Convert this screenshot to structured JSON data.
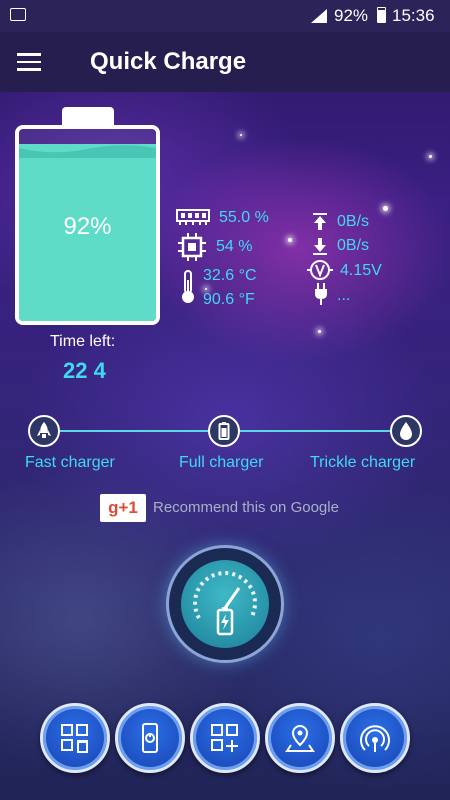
{
  "status_bar": {
    "battery_percent": "92%",
    "time": "15:36"
  },
  "app_bar": {
    "title": "Quick Charge",
    "menu_icon": "hamburger-menu-icon"
  },
  "battery": {
    "level_percent": 92,
    "label": "92%",
    "fill_color": "#5fdcc8"
  },
  "time_left": {
    "label": "Time left:",
    "value": "22 4"
  },
  "stats": {
    "ram": "55.0 %",
    "cpu": "54 %",
    "temp_c": "32.6 °C",
    "temp_f": "90.6 °F",
    "upload": "0B/s",
    "download": "0B/s",
    "voltage": "4.15V",
    "plug": "..."
  },
  "charge_modes": [
    {
      "label": "Fast charger",
      "icon": "rocket-icon"
    },
    {
      "label": "Full charger",
      "icon": "battery-icon"
    },
    {
      "label": "Trickle charger",
      "icon": "droplet-icon"
    }
  ],
  "recommend": {
    "badge": "g+1",
    "text": "Recommend this on Google"
  },
  "boost_button": {
    "icon": "speedometer-battery-icon"
  },
  "bottom_buttons": [
    {
      "icon": "apps-cleaner-icon"
    },
    {
      "icon": "phone-power-icon"
    },
    {
      "icon": "apps-add-icon"
    },
    {
      "icon": "location-pin-icon"
    },
    {
      "icon": "wireless-signal-icon"
    }
  ],
  "colors": {
    "accent": "#41d8f2",
    "battery": "#5fdcc8",
    "button": "#1d4fbf"
  }
}
